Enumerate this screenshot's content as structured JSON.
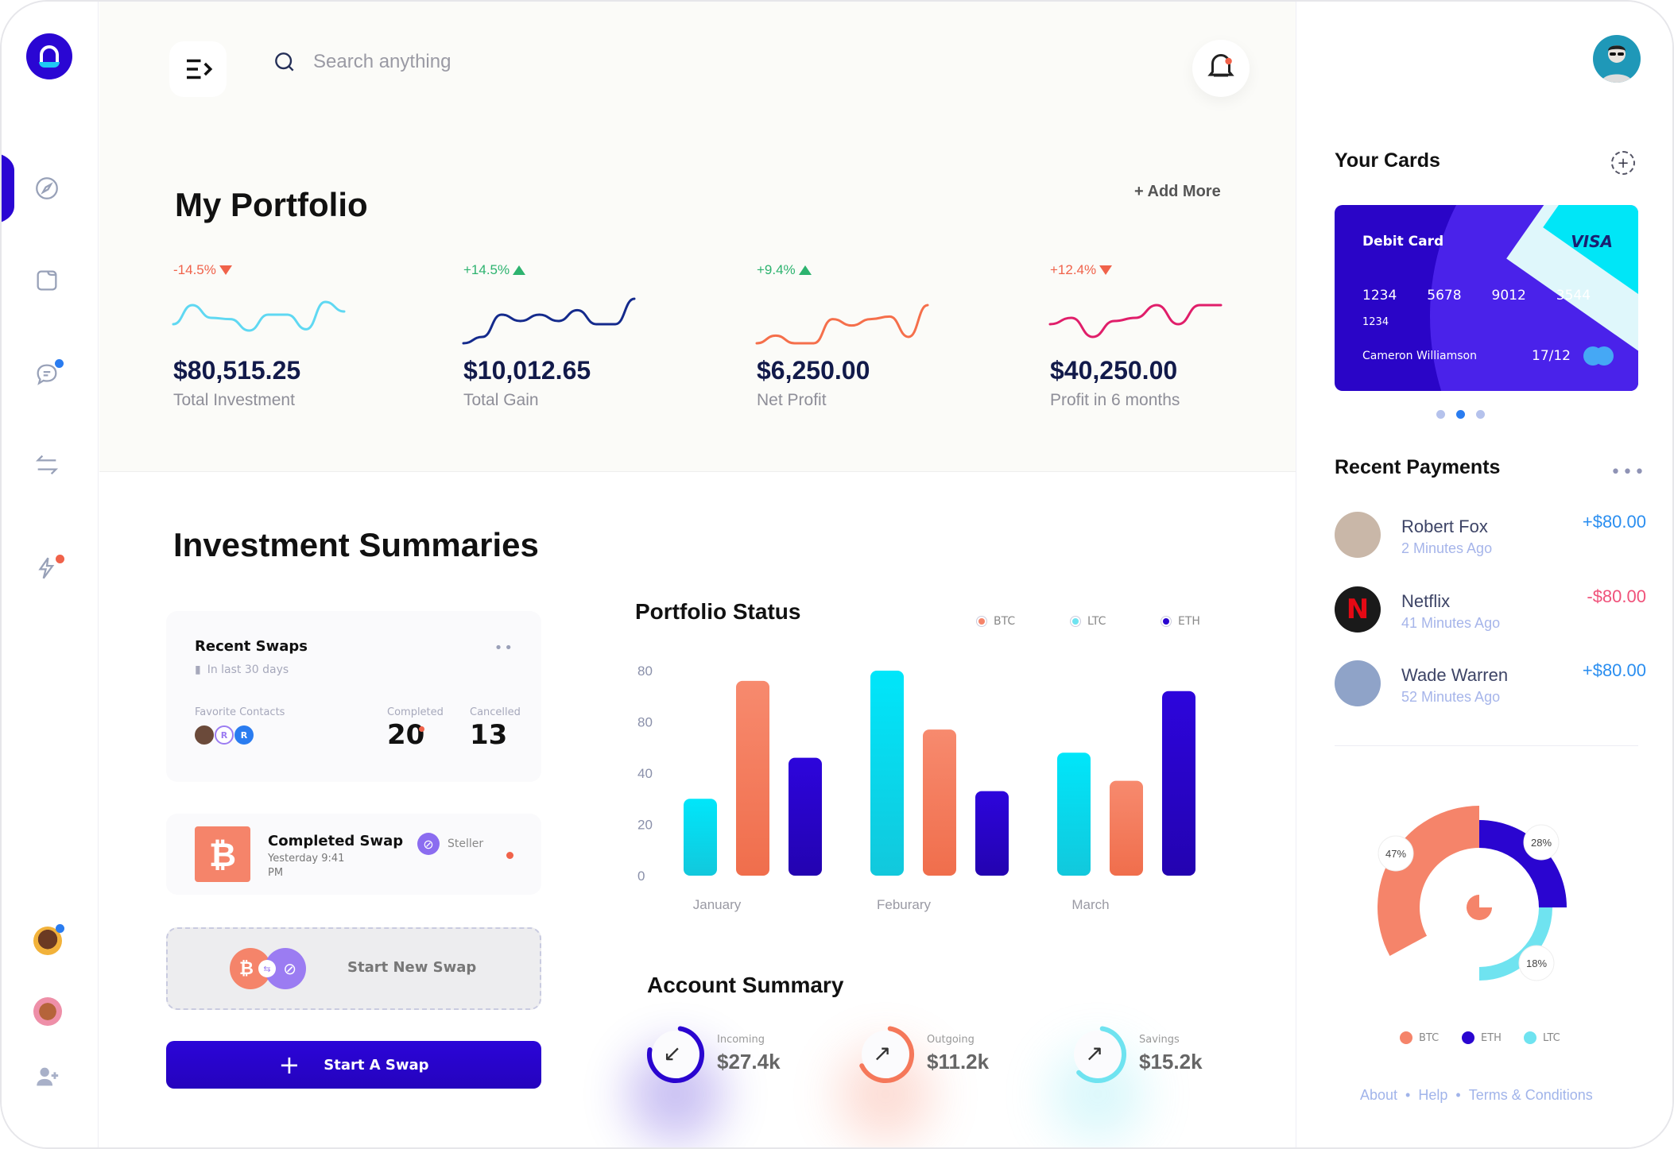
{
  "sidebar": {
    "nav": [
      {
        "icon": "compass-icon",
        "active": true,
        "badge": null
      },
      {
        "icon": "folder-icon",
        "active": false,
        "badge": null
      },
      {
        "icon": "chat-icon",
        "active": false,
        "badge": "#2a7cf0"
      },
      {
        "icon": "exchange-icon",
        "active": false,
        "badge": null
      },
      {
        "icon": "lightning-icon",
        "active": false,
        "badge": "#f0624a"
      }
    ],
    "contacts": [
      {
        "icon": "contact-avatar-1",
        "online": true
      },
      {
        "icon": "contact-avatar-2",
        "online": false
      }
    ],
    "add_user_icon": "add-user-icon"
  },
  "header": {
    "search_placeholder": "Search anything",
    "notifications_unread": true
  },
  "portfolio": {
    "title": "My Portfolio",
    "add_more": "+ Add More",
    "stats": [
      {
        "change": "-14.5%",
        "direction": "down",
        "change_color": "#f0624a",
        "value": "$80,515.25",
        "label": "Total Investment",
        "line_color": "#5fd8f2",
        "spark": [
          40,
          70,
          50,
          48,
          30,
          55,
          55,
          32,
          75,
          60
        ]
      },
      {
        "change": "+14.5%",
        "direction": "up",
        "change_color": "#2db36f",
        "value": "$10,012.65",
        "label": "Total Gain",
        "line_color": "#142a8c",
        "spark": [
          10,
          20,
          55,
          45,
          55,
          45,
          62,
          40,
          40,
          80
        ]
      },
      {
        "change": "+9.4%",
        "direction": "up",
        "change_color": "#2db36f",
        "value": "$6,250.00",
        "label": "Net Profit",
        "line_color": "#f56f4b",
        "spark": [
          10,
          22,
          10,
          10,
          48,
          38,
          48,
          52,
          20,
          70
        ]
      },
      {
        "change": "+12.4%",
        "direction": "down",
        "change_color": "#f0624a",
        "value": "$40,250.00",
        "label": "Profit in 6 months",
        "line_color": "#e01e6a",
        "spark": [
          40,
          50,
          20,
          45,
          50,
          70,
          40,
          70,
          70
        ]
      }
    ]
  },
  "investment": {
    "title": "Investment Summaries",
    "recent_swaps": {
      "title": "Recent Swaps",
      "period": "In last 30 days",
      "favorite_label": "Favorite Contacts",
      "contacts": [
        "",
        "R",
        "R"
      ],
      "completed_label": "Completed",
      "completed": "20",
      "cancelled_label": "Cancelled",
      "cancelled": "13"
    },
    "completed_swap": {
      "title": "Completed Swap",
      "time": "Yesterday 9:41 PM",
      "coin": "Steller"
    },
    "new_swap_label": "Start New Swap",
    "start_button": "Start A Swap"
  },
  "chart_data": [
    {
      "type": "bar",
      "title": "Portfolio Status",
      "categories": [
        "January",
        "Feburary",
        "March"
      ],
      "series": [
        {
          "name": "LTC",
          "color": "#00e2f5",
          "values": [
            30,
            80,
            48
          ]
        },
        {
          "name": "BTC",
          "color": "#f5846a",
          "values": [
            76,
            57,
            37
          ]
        },
        {
          "name": "ETH",
          "color": "#2a05d0",
          "values": [
            46,
            33,
            72
          ]
        }
      ],
      "legend": [
        "BTC",
        "LTC",
        "ETH"
      ],
      "legend_placement": "top-right",
      "ytick_labels": [
        "80",
        "80",
        "40",
        "20",
        "0"
      ],
      "ylim": [
        0,
        80
      ],
      "grid": false,
      "xlabel": "",
      "ylabel": ""
    },
    {
      "type": "pie",
      "title": "",
      "series": [
        {
          "name": "BTC",
          "value": 47,
          "label": "47%",
          "color": "#f5846a"
        },
        {
          "name": "ETH",
          "value": 28,
          "label": "28%",
          "color": "#2a05d0"
        },
        {
          "name": "LTC",
          "value": 18,
          "label": "18%",
          "color": "#6fe3f0"
        }
      ],
      "legend": [
        "BTC",
        "ETH",
        "LTC"
      ],
      "legend_placement": "bottom"
    }
  ],
  "account_summary": {
    "title": "Account Summary",
    "items": [
      {
        "label": "Incoming",
        "value": "$27.4k",
        "arrow": "↙",
        "color": "#2a05d0",
        "progress": 0.75
      },
      {
        "label": "Outgoing",
        "value": "$11.2k",
        "arrow": "↗",
        "color": "#f5785a",
        "progress": 0.65
      },
      {
        "label": "Savings",
        "value": "$15.2k",
        "arrow": "↗",
        "color": "#6fe3f0",
        "progress": 0.6
      }
    ]
  },
  "right": {
    "cards_title": "Your Cards",
    "card": {
      "type": "Debit Card",
      "brand": "VISA",
      "number": [
        "1234",
        "5678",
        "9012",
        "3544"
      ],
      "number_short": "1234",
      "holder": "Cameron Williamson",
      "expiry": "17/12"
    },
    "card_pages": 3,
    "card_page_active": 2,
    "payments_title": "Recent Payments",
    "payments": [
      {
        "name": "Robert Fox",
        "time": "2 Minutes Ago",
        "amount": "+$80.00",
        "color": "#2a8ef0",
        "avatar": "#c9b7a8"
      },
      {
        "name": "Netflix",
        "time": "41 Minutes Ago",
        "amount": "-$80.00",
        "color": "#f0527a",
        "avatar": "#1a1a1a"
      },
      {
        "name": "Wade Warren",
        "time": "52 Minutes Ago",
        "amount": "+$80.00",
        "color": "#2a8ef0",
        "avatar": "#8fa3c8"
      }
    ],
    "footer": [
      "About",
      "Help",
      "Terms & Conditions"
    ]
  }
}
